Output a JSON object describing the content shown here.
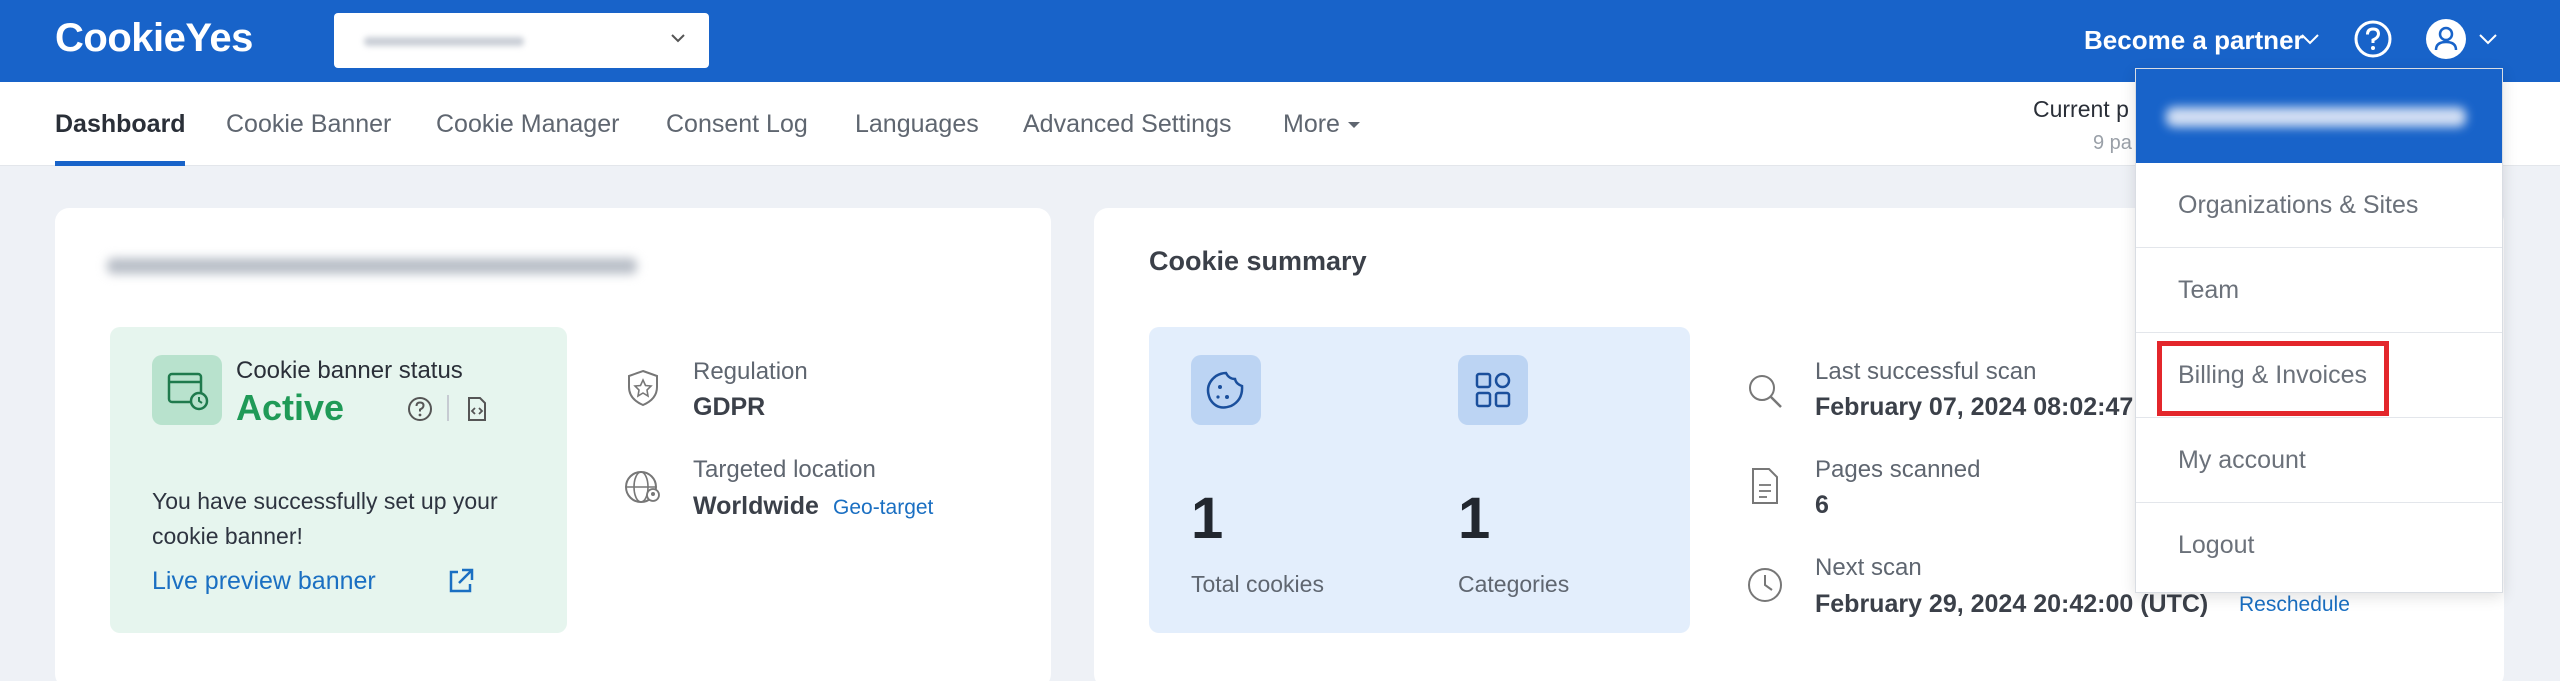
{
  "brand": {
    "logo": "CookieYes",
    "accent": "#1863c9"
  },
  "header": {
    "partner_label": "Become a partner"
  },
  "nav": {
    "tabs": [
      "Dashboard",
      "Cookie Banner",
      "Cookie Manager",
      "Consent Log",
      "Languages",
      "Advanced Settings",
      "More"
    ],
    "active_tab": "Dashboard",
    "current_plan": "Current p",
    "pages_sub": "9 pa"
  },
  "banner_card": {
    "status_label": "Cookie banner status",
    "status_value": "Active",
    "success_message": "You have successfully set up your cookie banner!",
    "live_preview": "Live preview banner",
    "regulation_label": "Regulation",
    "regulation_value": "GDPR",
    "location_label": "Targeted location",
    "location_value": "Worldwide",
    "geo_link": "Geo-target"
  },
  "summary_card": {
    "title": "Cookie summary",
    "total_cookies_value": "1",
    "total_cookies_label": "Total cookies",
    "categories_value": "1",
    "categories_label": "Categories",
    "last_scan_label": "Last successful scan",
    "last_scan_value": "February 07, 2024 08:02:47",
    "pages_scanned_label": "Pages scanned",
    "pages_scanned_value": "6",
    "next_scan_label": "Next scan",
    "next_scan_value": "February 29, 2024 20:42:00 (UTC)",
    "reschedule": "Reschedule"
  },
  "account_menu": {
    "items": [
      "Organizations & Sites",
      "Team",
      "Billing & Invoices",
      "My account",
      "Logout"
    ],
    "highlighted": "Billing & Invoices"
  }
}
